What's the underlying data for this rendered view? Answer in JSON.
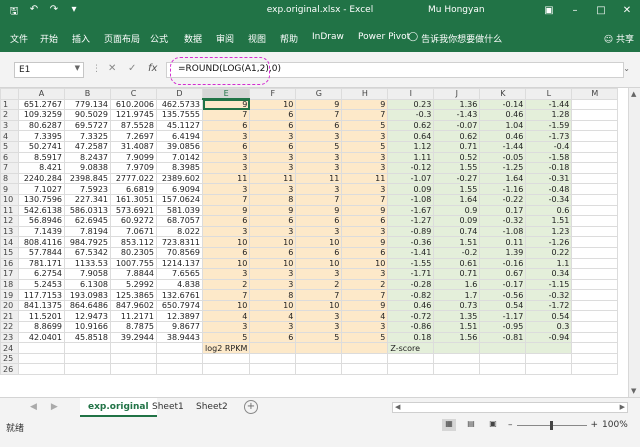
{
  "titlebar": {
    "icons": [
      "save-icon",
      "undo-icon",
      "redo-icon",
      "customize-icon"
    ],
    "title": "exp.original.xlsx  -  Excel",
    "user": "Mu Hongyan",
    "controls": [
      "ribbon-display-icon",
      "minimize-icon",
      "maximize-icon",
      "close-icon"
    ]
  },
  "ribbon": {
    "tabs": [
      "文件",
      "开始",
      "插入",
      "页面布局",
      "公式",
      "数据",
      "审阅",
      "视图",
      "帮助",
      "InDraw",
      "Power Pivot"
    ],
    "search_label": "告诉我你想要做什么",
    "share_label": "共享"
  },
  "formula_bar": {
    "name_box": "E1",
    "formula": "=ROUND(LOG(A1,2),0)"
  },
  "grid": {
    "columns": [
      "A",
      "B",
      "C",
      "D",
      "E",
      "F",
      "G",
      "H",
      "I",
      "J",
      "K",
      "L",
      "M"
    ],
    "selected_column": "E",
    "rows": [
      [
        "651.2767",
        "779.134",
        "610.2006",
        "462.5733",
        "9",
        "10",
        "9",
        "9",
        "0.23",
        "1.36",
        "-0.14",
        "-1.44"
      ],
      [
        "109.3259",
        "90.5029",
        "121.9745",
        "135.7555",
        "7",
        "6",
        "7",
        "7",
        "-0.3",
        "-1.43",
        "0.46",
        "1.28"
      ],
      [
        "80.6287",
        "69.5727",
        "87.5528",
        "45.1127",
        "6",
        "6",
        "6",
        "5",
        "0.62",
        "-0.07",
        "1.04",
        "-1.59"
      ],
      [
        "7.3395",
        "7.3325",
        "7.2697",
        "6.4194",
        "3",
        "3",
        "3",
        "3",
        "0.64",
        "0.62",
        "0.46",
        "-1.73"
      ],
      [
        "50.2741",
        "47.2587",
        "31.4087",
        "39.0856",
        "6",
        "6",
        "5",
        "5",
        "1.12",
        "0.71",
        "-1.44",
        "-0.4"
      ],
      [
        "8.5917",
        "8.2437",
        "7.9099",
        "7.0142",
        "3",
        "3",
        "3",
        "3",
        "1.11",
        "0.52",
        "-0.05",
        "-1.58"
      ],
      [
        "8.421",
        "9.0838",
        "7.9709",
        "8.3985",
        "3",
        "3",
        "3",
        "3",
        "-0.12",
        "1.55",
        "-1.25",
        "-0.18"
      ],
      [
        "2240.284",
        "2398.845",
        "2777.022",
        "2389.602",
        "11",
        "11",
        "11",
        "11",
        "-1.07",
        "-0.27",
        "1.64",
        "-0.31"
      ],
      [
        "7.1027",
        "7.5923",
        "6.6819",
        "6.9094",
        "3",
        "3",
        "3",
        "3",
        "0.09",
        "1.55",
        "-1.16",
        "-0.48"
      ],
      [
        "130.7596",
        "227.341",
        "161.3051",
        "157.0624",
        "7",
        "8",
        "7",
        "7",
        "-1.08",
        "1.64",
        "-0.22",
        "-0.34"
      ],
      [
        "542.6138",
        "586.0313",
        "573.6921",
        "581.039",
        "9",
        "9",
        "9",
        "9",
        "-1.67",
        "0.9",
        "0.17",
        "0.6"
      ],
      [
        "56.8946",
        "62.6945",
        "60.9272",
        "68.7057",
        "6",
        "6",
        "6",
        "6",
        "-1.27",
        "0.09",
        "-0.32",
        "1.51"
      ],
      [
        "7.1439",
        "7.8194",
        "7.0671",
        "8.022",
        "3",
        "3",
        "3",
        "3",
        "-0.89",
        "0.74",
        "-1.08",
        "1.23"
      ],
      [
        "808.4116",
        "984.7925",
        "853.112",
        "723.8311",
        "10",
        "10",
        "10",
        "9",
        "-0.36",
        "1.51",
        "0.11",
        "-1.26"
      ],
      [
        "57.7844",
        "67.5342",
        "80.2305",
        "70.8569",
        "6",
        "6",
        "6",
        "6",
        "-1.41",
        "-0.2",
        "1.39",
        "0.22"
      ],
      [
        "781.171",
        "1133.53",
        "1007.755",
        "1214.137",
        "10",
        "10",
        "10",
        "10",
        "-1.55",
        "0.61",
        "-0.16",
        "1.1"
      ],
      [
        "6.2754",
        "7.9058",
        "7.8844",
        "7.6565",
        "3",
        "3",
        "3",
        "3",
        "-1.71",
        "0.71",
        "0.67",
        "0.34"
      ],
      [
        "5.2453",
        "6.1308",
        "5.2992",
        "4.838",
        "2",
        "3",
        "2",
        "2",
        "-0.28",
        "1.6",
        "-0.17",
        "-1.15"
      ],
      [
        "117.7153",
        "193.0983",
        "125.3865",
        "132.6761",
        "7",
        "8",
        "7",
        "7",
        "-0.82",
        "1.7",
        "-0.56",
        "-0.32"
      ],
      [
        "841.1375",
        "864.6486",
        "847.9602",
        "650.7974",
        "10",
        "10",
        "10",
        "9",
        "0.46",
        "0.73",
        "0.54",
        "-1.72"
      ],
      [
        "11.5201",
        "12.9473",
        "11.2171",
        "12.3897",
        "4",
        "4",
        "3",
        "4",
        "-0.72",
        "1.35",
        "-1.17",
        "0.54"
      ],
      [
        "8.8699",
        "10.9166",
        "8.7875",
        "9.8677",
        "3",
        "3",
        "3",
        "3",
        "-0.86",
        "1.51",
        "-0.95",
        "0.3"
      ],
      [
        "42.0401",
        "45.8518",
        "39.2944",
        "38.9443",
        "5",
        "6",
        "5",
        "5",
        "0.18",
        "1.56",
        "-0.81",
        "-0.94"
      ]
    ],
    "label_row": {
      "log_label": "log2 RPKM",
      "z_label": "Z-score"
    },
    "total_rows": 26
  },
  "sheets": {
    "tabs": [
      "exp.original",
      "Sheet1",
      "Sheet2"
    ],
    "active": "exp.original"
  },
  "statusbar": {
    "ready": "就绪",
    "zoom": "100%"
  }
}
